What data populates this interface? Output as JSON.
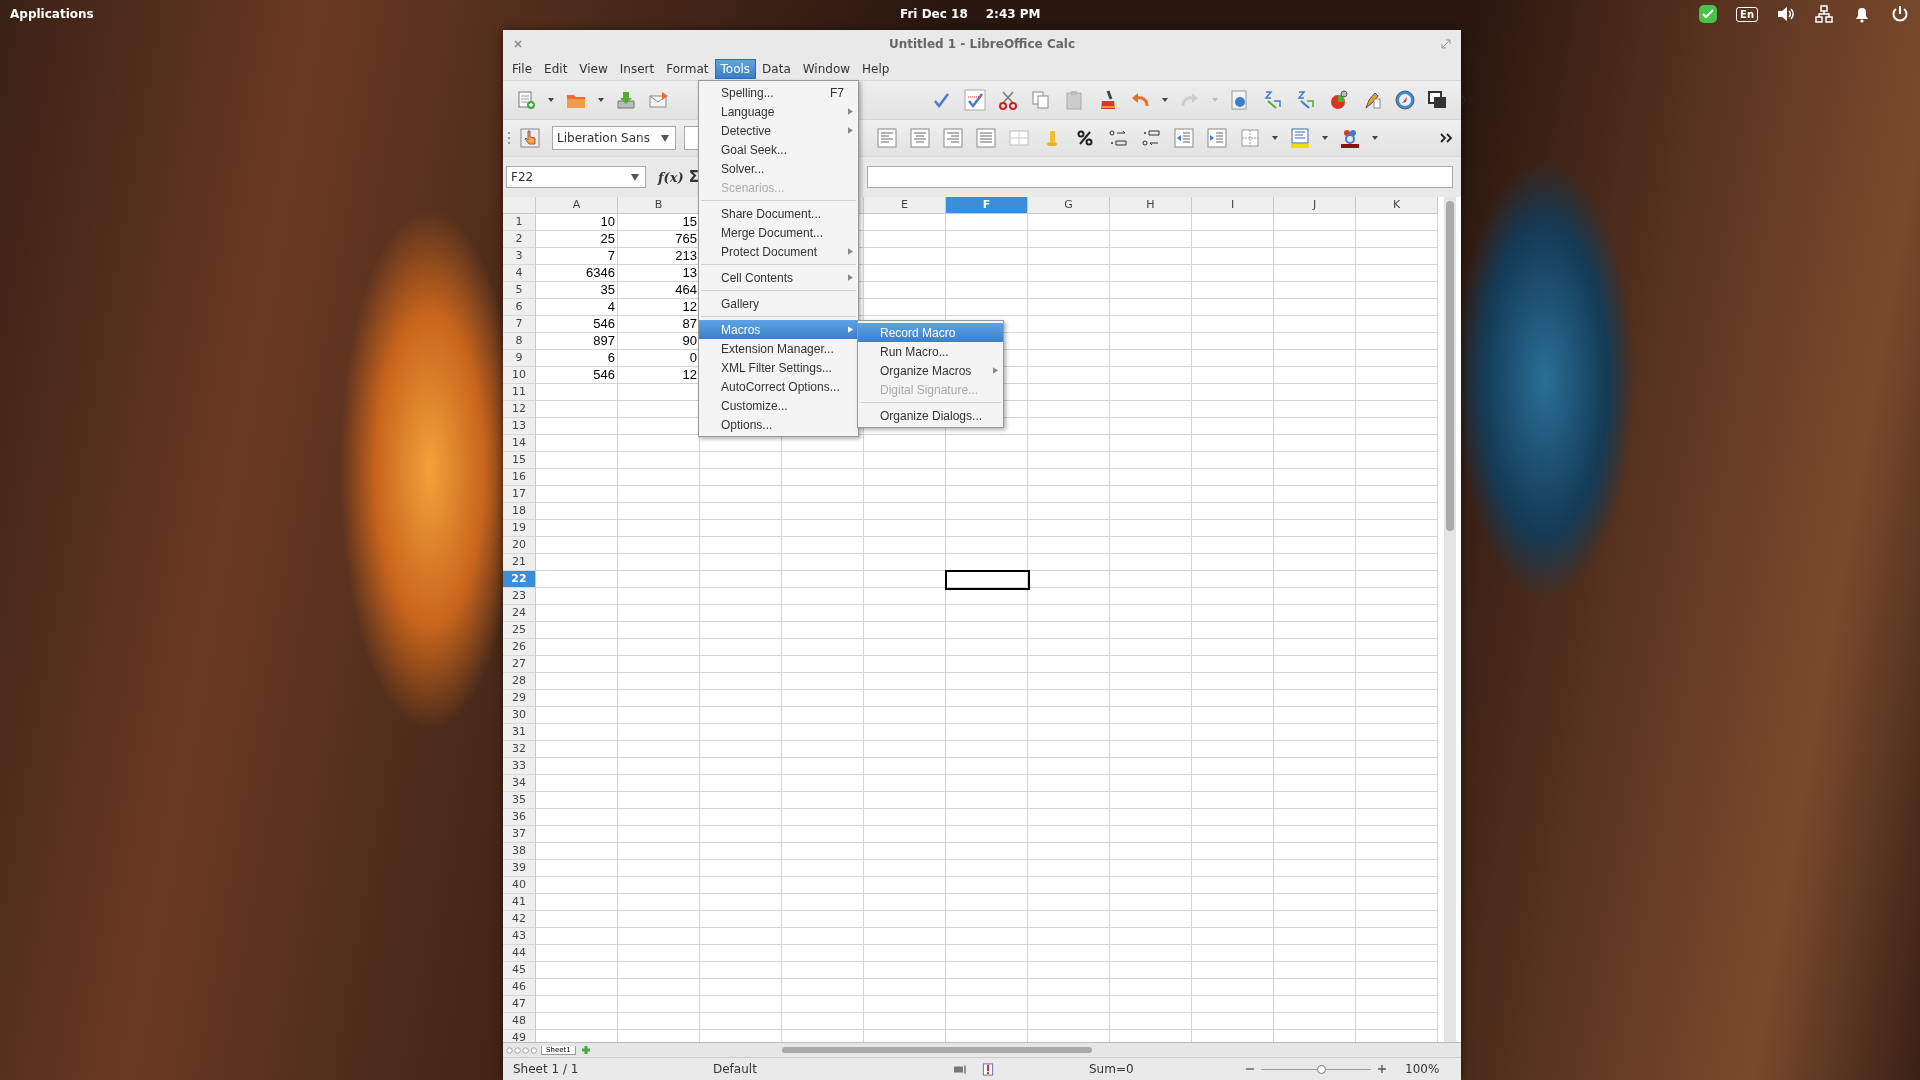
{
  "top_panel": {
    "applications": "Applications",
    "date": "Fri Dec 18",
    "time": "2:43 PM",
    "keyboard_layout": "En"
  },
  "window": {
    "title": "Untitled 1 - LibreOffice Calc"
  },
  "menu_bar": [
    {
      "label": "File",
      "selected": false
    },
    {
      "label": "Edit",
      "selected": false
    },
    {
      "label": "View",
      "selected": false
    },
    {
      "label": "Insert",
      "selected": false
    },
    {
      "label": "Format",
      "selected": false
    },
    {
      "label": "Tools",
      "selected": true
    },
    {
      "label": "Data",
      "selected": false
    },
    {
      "label": "Window",
      "selected": false
    },
    {
      "label": "Help",
      "selected": false
    }
  ],
  "tools_menu": {
    "groups": [
      [
        {
          "label": "Spelling...",
          "shortcut": "F7",
          "submenu": false,
          "disabled": false,
          "selected": false
        },
        {
          "label": "Language",
          "submenu": true,
          "disabled": false,
          "selected": false
        },
        {
          "label": "Detective",
          "submenu": true,
          "disabled": false,
          "selected": false
        },
        {
          "label": "Goal Seek...",
          "submenu": false,
          "disabled": false,
          "selected": false
        },
        {
          "label": "Solver...",
          "submenu": false,
          "disabled": false,
          "selected": false
        },
        {
          "label": "Scenarios...",
          "submenu": false,
          "disabled": true,
          "selected": false
        }
      ],
      [
        {
          "label": "Share Document...",
          "submenu": false,
          "disabled": false,
          "selected": false
        },
        {
          "label": "Merge Document...",
          "submenu": false,
          "disabled": false,
          "selected": false
        },
        {
          "label": "Protect Document",
          "submenu": true,
          "disabled": false,
          "selected": false
        }
      ],
      [
        {
          "label": "Cell Contents",
          "submenu": true,
          "disabled": false,
          "selected": false
        }
      ],
      [
        {
          "label": "Gallery",
          "submenu": false,
          "disabled": false,
          "selected": false
        }
      ],
      [
        {
          "label": "Macros",
          "submenu": true,
          "disabled": false,
          "selected": true
        },
        {
          "label": "Extension Manager...",
          "submenu": false,
          "disabled": false,
          "selected": false
        },
        {
          "label": "XML Filter Settings...",
          "submenu": false,
          "disabled": false,
          "selected": false
        },
        {
          "label": "AutoCorrect Options...",
          "submenu": false,
          "disabled": false,
          "selected": false
        },
        {
          "label": "Customize...",
          "submenu": false,
          "disabled": false,
          "selected": false
        },
        {
          "label": "Options...",
          "submenu": false,
          "disabled": false,
          "selected": false
        }
      ]
    ]
  },
  "macros_submenu": {
    "groups": [
      [
        {
          "label": "Record Macro",
          "submenu": false,
          "disabled": false,
          "selected": true
        },
        {
          "label": "Run Macro...",
          "submenu": false,
          "disabled": false,
          "selected": false
        },
        {
          "label": "Organize Macros",
          "submenu": true,
          "disabled": false,
          "selected": false
        },
        {
          "label": "Digital Signature...",
          "submenu": false,
          "disabled": true,
          "selected": false
        }
      ],
      [
        {
          "label": "Organize Dialogs...",
          "submenu": false,
          "disabled": false,
          "selected": false
        }
      ]
    ]
  },
  "formatting_toolbar": {
    "font_name": "Liberation Sans"
  },
  "formula_bar": {
    "name_box": "F22",
    "function_wizard": "f(x)",
    "sum": "Σ"
  },
  "columns": [
    {
      "label": "A",
      "selected": false
    },
    {
      "label": "B",
      "selected": false
    },
    {},
    {},
    {
      "label": "E",
      "selected": false
    },
    {
      "label": "F",
      "selected": true
    },
    {
      "label": "G",
      "selected": false
    },
    {
      "label": "H",
      "selected": false
    },
    {
      "label": "I",
      "selected": false
    },
    {
      "label": "J",
      "selected": false
    },
    {
      "label": "K",
      "selected": false
    }
  ],
  "rows": [
    {
      "number": "1",
      "selected": false,
      "cells": [
        "10",
        "15"
      ]
    },
    {
      "number": "2",
      "selected": false,
      "cells": [
        "25",
        "765"
      ]
    },
    {
      "number": "3",
      "selected": false,
      "cells": [
        "7",
        "213"
      ]
    },
    {
      "number": "4",
      "selected": false,
      "cells": [
        "6346",
        "13"
      ]
    },
    {
      "number": "5",
      "selected": false,
      "cells": [
        "35",
        "464"
      ]
    },
    {
      "number": "6",
      "selected": false,
      "cells": [
        "4",
        "12"
      ]
    },
    {
      "number": "7",
      "selected": false,
      "cells": [
        "546",
        "87"
      ]
    },
    {
      "number": "8",
      "selected": false,
      "cells": [
        "897",
        "90"
      ]
    },
    {
      "number": "9",
      "selected": false,
      "cells": [
        "6",
        "0"
      ]
    },
    {
      "number": "10",
      "selected": false,
      "cells": [
        "546",
        "12"
      ]
    },
    {
      "number": "11",
      "selected": false,
      "cells": []
    },
    {
      "number": "12",
      "selected": false,
      "cells": []
    },
    {
      "number": "13",
      "selected": false,
      "cells": []
    },
    {
      "number": "14",
      "selected": false,
      "cells": []
    },
    {
      "number": "15",
      "selected": false,
      "cells": []
    },
    {
      "number": "16",
      "selected": false,
      "cells": []
    },
    {
      "number": "17",
      "selected": false,
      "cells": []
    },
    {
      "number": "18",
      "selected": false,
      "cells": []
    },
    {
      "number": "19",
      "selected": false,
      "cells": []
    },
    {
      "number": "20",
      "selected": false,
      "cells": []
    },
    {
      "number": "21",
      "selected": false,
      "cells": []
    },
    {
      "number": "22",
      "selected": true,
      "cells": []
    },
    {
      "number": "23",
      "selected": false,
      "cells": []
    },
    {
      "number": "24",
      "selected": false,
      "cells": []
    },
    {
      "number": "25",
      "selected": false,
      "cells": []
    },
    {
      "number": "26",
      "selected": false,
      "cells": []
    },
    {
      "number": "27",
      "selected": false,
      "cells": []
    },
    {
      "number": "28",
      "selected": false,
      "cells": []
    },
    {
      "number": "29",
      "selected": false,
      "cells": []
    },
    {
      "number": "30",
      "selected": false,
      "cells": []
    },
    {
      "number": "31",
      "selected": false,
      "cells": []
    },
    {
      "number": "32",
      "selected": false,
      "cells": []
    },
    {
      "number": "33",
      "selected": false,
      "cells": []
    },
    {
      "number": "34",
      "selected": false,
      "cells": []
    },
    {
      "number": "35",
      "selected": false,
      "cells": []
    },
    {
      "number": "36",
      "selected": false,
      "cells": []
    },
    {
      "number": "37",
      "selected": false,
      "cells": []
    },
    {
      "number": "38",
      "selected": false,
      "cells": []
    },
    {
      "number": "39",
      "selected": false,
      "cells": []
    },
    {
      "number": "40",
      "selected": false,
      "cells": []
    },
    {
      "number": "41",
      "selected": false,
      "cells": []
    },
    {
      "number": "42",
      "selected": false,
      "cells": []
    },
    {
      "number": "43",
      "selected": false,
      "cells": []
    },
    {
      "number": "44",
      "selected": false,
      "cells": []
    },
    {
      "number": "45",
      "selected": false,
      "cells": []
    },
    {
      "number": "46",
      "selected": false,
      "cells": []
    },
    {
      "number": "47",
      "selected": false,
      "cells": []
    },
    {
      "number": "48",
      "selected": false,
      "cells": []
    },
    {
      "number": "49",
      "selected": false,
      "cells": []
    }
  ],
  "sheet_tabs": [
    {
      "label": "Sheet1",
      "selected": true
    }
  ],
  "status_bar": {
    "sheet": "Sheet 1 / 1",
    "page_style": "Default",
    "sum": "Sum=0",
    "zoom": {
      "level": 0.55,
      "reading": "100%"
    }
  }
}
